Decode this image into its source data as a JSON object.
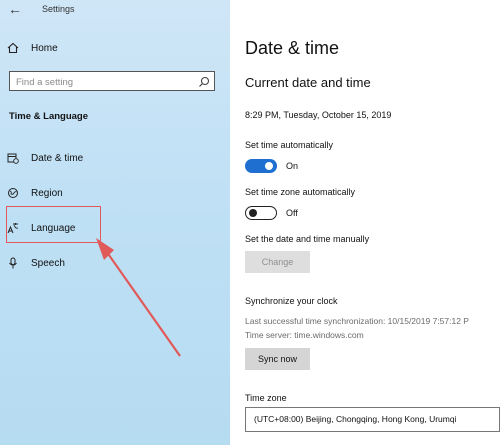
{
  "window": {
    "title": "Settings"
  },
  "sidebar": {
    "home_label": "Home",
    "search_placeholder": "Find a setting",
    "section_title": "Time & Language",
    "items": [
      {
        "label": "Date & time",
        "icon": "calendar-clock-icon"
      },
      {
        "label": "Region",
        "icon": "globe-icon"
      },
      {
        "label": "Language",
        "icon": "language-icon"
      },
      {
        "label": "Speech",
        "icon": "microphone-icon"
      }
    ]
  },
  "main": {
    "title": "Date & time",
    "subtitle": "Current date and time",
    "current_datetime": "8:29 PM, Tuesday, October 15, 2019",
    "set_time_auto": {
      "label": "Set time automatically",
      "state": "On"
    },
    "set_timezone_auto": {
      "label": "Set time zone automatically",
      "state": "Off"
    },
    "manual": {
      "label": "Set the date and time manually",
      "button": "Change"
    },
    "sync": {
      "title": "Synchronize your clock",
      "last_sync": "Last successful time synchronization: 10/15/2019 7:57:12 P",
      "time_server": "Time server: time.windows.com",
      "button": "Sync now"
    },
    "timezone": {
      "label": "Time zone",
      "value": "(UTC+08:00) Beijing, Chongqing, Hong Kong, Urumqi"
    }
  },
  "colors": {
    "accent": "#1f6fd1",
    "annotation": "#e05a5a",
    "sidebar_bg": "#c4e2f5"
  }
}
